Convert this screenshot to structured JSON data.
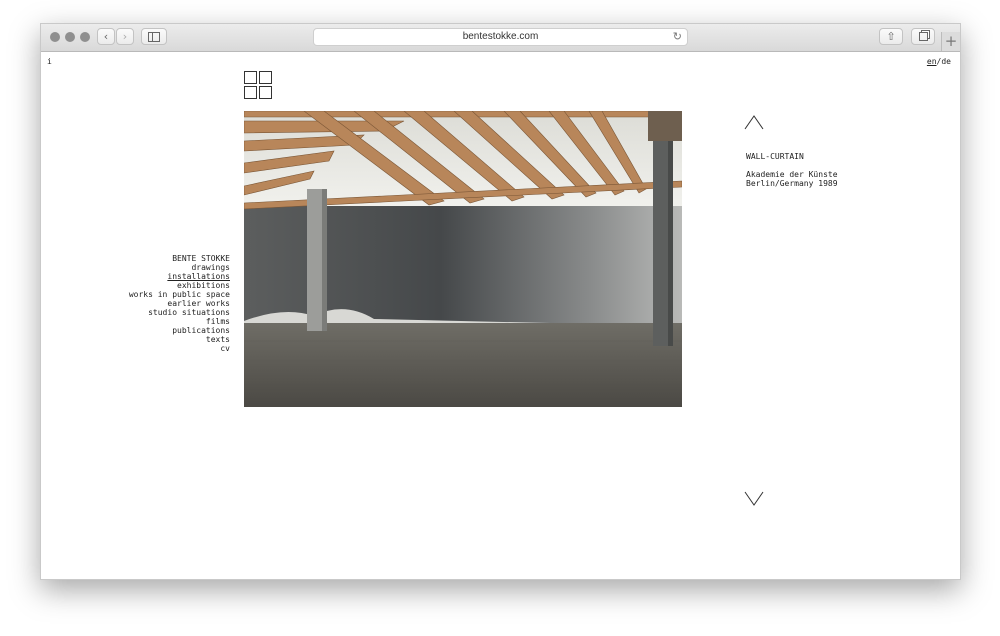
{
  "browser": {
    "url": "bentestokke.com",
    "back_icon": "chevron-left-icon",
    "forward_icon": "chevron-right-icon",
    "sidebar_icon": "sidebar-icon",
    "reload_icon": "reload-icon",
    "share_icon": "share-icon",
    "tabs_icon": "tabs-icon",
    "new_tab_icon": "plus-icon"
  },
  "page": {
    "info_link": "i",
    "lang": {
      "en": "en",
      "separator": "/",
      "de": "de",
      "active": "en"
    },
    "grid_icon": "grid-icon",
    "nav": {
      "items": [
        {
          "label": "BENTE STOKKE"
        },
        {
          "label": "drawings"
        },
        {
          "label": "installations",
          "selected": true
        },
        {
          "label": "exhibitions"
        },
        {
          "label": "works in public space"
        },
        {
          "label": "earlier works"
        },
        {
          "label": "studio situations"
        },
        {
          "label": "films"
        },
        {
          "label": "publications"
        },
        {
          "label": "texts"
        },
        {
          "label": "cv"
        }
      ]
    },
    "caption": {
      "title": "WALL-CURTAIN",
      "line1": "Akademie der Künste",
      "line2": "Berlin/Germany 1989"
    },
    "arrows": {
      "up_icon": "arrow-up-icon",
      "down_icon": "arrow-down-icon"
    }
  },
  "colors": {
    "text": "#222222",
    "toolbar": "#e3e3e3",
    "photo_wall": "#6a6c6b",
    "photo_wood": "#b98a5e"
  }
}
